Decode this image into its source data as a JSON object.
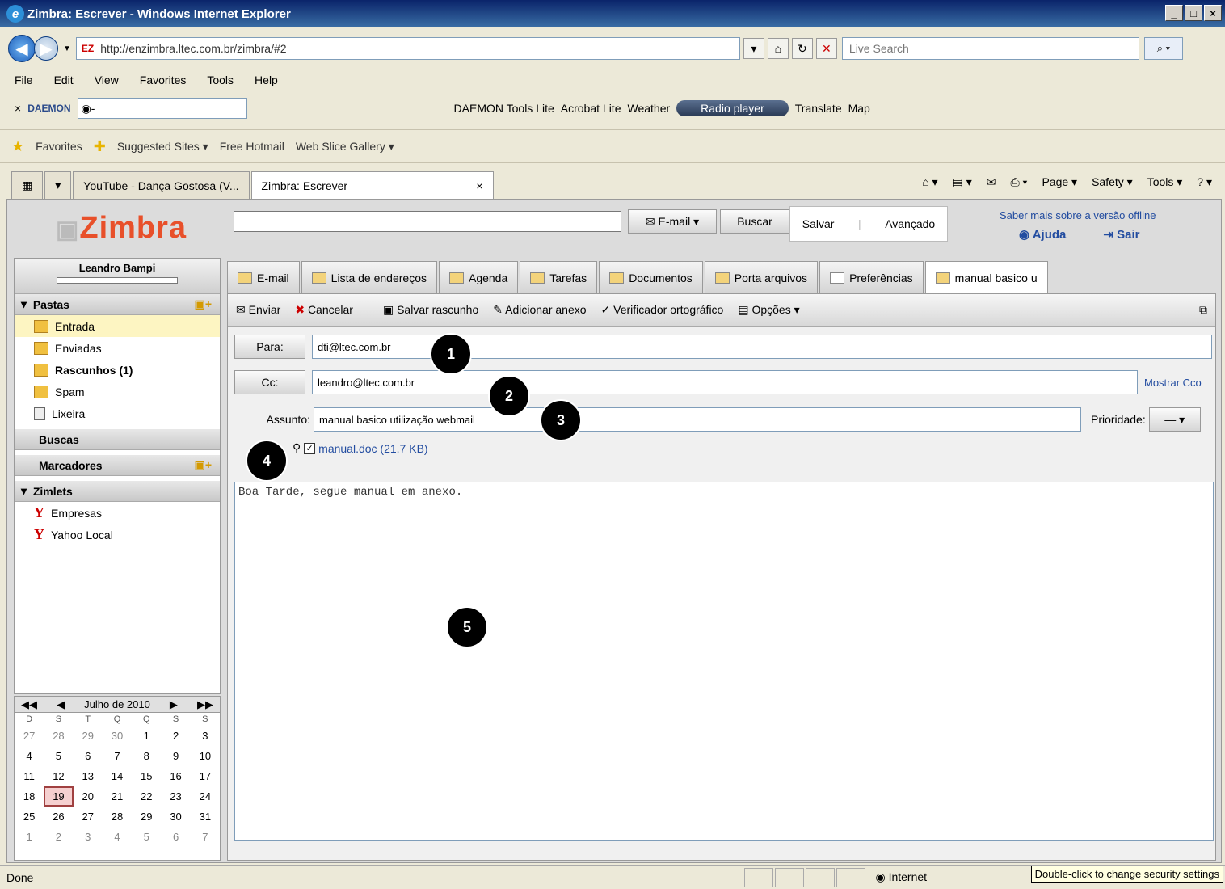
{
  "browser": {
    "title": "Zimbra: Escrever - Windows Internet Explorer",
    "address": "http://enzimbra.ltec.com.br/zimbra/#2",
    "search_placeholder": "Live Search",
    "menu": [
      "File",
      "Edit",
      "View",
      "Favorites",
      "Tools",
      "Help"
    ],
    "daemon_label": "DAEMON",
    "daemon_items": [
      "DAEMON Tools Lite",
      "Acrobat Lite",
      "Weather",
      "Radio player",
      "Translate",
      "Map"
    ],
    "favorites": [
      "Favorites",
      "Suggested Sites ▾",
      "Free Hotmail",
      "Web Slice Gallery ▾"
    ],
    "tabs": [
      "YouTube - Dança Gostosa (V...",
      "Zimbra: Escrever"
    ],
    "right_tools": [
      "Page ▾",
      "Safety ▾",
      "Tools ▾"
    ],
    "status_left": "Done",
    "status_zone": "Internet",
    "status_tooltip": "Double-click to change security settings"
  },
  "zimbra": {
    "logo": "Zimbra",
    "search_type": "E-mail",
    "search_button": "Buscar",
    "saved_links": [
      "Salvar",
      "Avançado"
    ],
    "offline_text": "Saber mais sobre a versão offline",
    "help": "Ajuda",
    "logout": "Sair",
    "user": "Leandro Bampi",
    "sections": {
      "folders": "Pastas",
      "searches": "Buscas",
      "tags": "Marcadores",
      "zimlets": "Zimlets"
    },
    "folders": [
      {
        "label": "Entrada",
        "bold": false
      },
      {
        "label": "Enviadas",
        "bold": false
      },
      {
        "label": "Rascunhos (1)",
        "bold": true
      },
      {
        "label": "Spam",
        "bold": false
      },
      {
        "label": "Lixeira",
        "bold": false
      }
    ],
    "zimlets": [
      "Empresas",
      "Yahoo Local"
    ],
    "app_tabs": [
      "E-mail",
      "Lista de endereços",
      "Agenda",
      "Tarefas",
      "Documentos",
      "Porta arquivos",
      "Preferências",
      "manual basico u"
    ],
    "compose_toolbar": [
      "Enviar",
      "Cancelar",
      "Salvar rascunho",
      "Adicionar anexo",
      "Verificador ortográfico",
      "Opções"
    ],
    "to_label": "Para:",
    "to_value": "dti@ltec.com.br",
    "cc_label": "Cc:",
    "cc_value": "leandro@ltec.com.br",
    "show_bcc": "Mostrar Cco",
    "subject_label": "Assunto:",
    "subject_value": "manual basico utilização webmail",
    "priority_label": "Prioridade:",
    "priority_value": "—",
    "attachment": "manual.doc (21.7 KB)",
    "body": "Boa Tarde, segue manual em anexo."
  },
  "calendar": {
    "month": "Julho de 2010",
    "dow": [
      "D",
      "S",
      "T",
      "Q",
      "Q",
      "S",
      "S"
    ],
    "weeks": [
      [
        "27",
        "28",
        "29",
        "30",
        "1",
        "2",
        "3"
      ],
      [
        "4",
        "5",
        "6",
        "7",
        "8",
        "9",
        "10"
      ],
      [
        "11",
        "12",
        "13",
        "14",
        "15",
        "16",
        "17"
      ],
      [
        "18",
        "19",
        "20",
        "21",
        "22",
        "23",
        "24"
      ],
      [
        "25",
        "26",
        "27",
        "28",
        "29",
        "30",
        "31"
      ],
      [
        "1",
        "2",
        "3",
        "4",
        "5",
        "6",
        "7"
      ]
    ],
    "today": "19"
  },
  "markers": [
    "1",
    "2",
    "3",
    "4",
    "5"
  ]
}
